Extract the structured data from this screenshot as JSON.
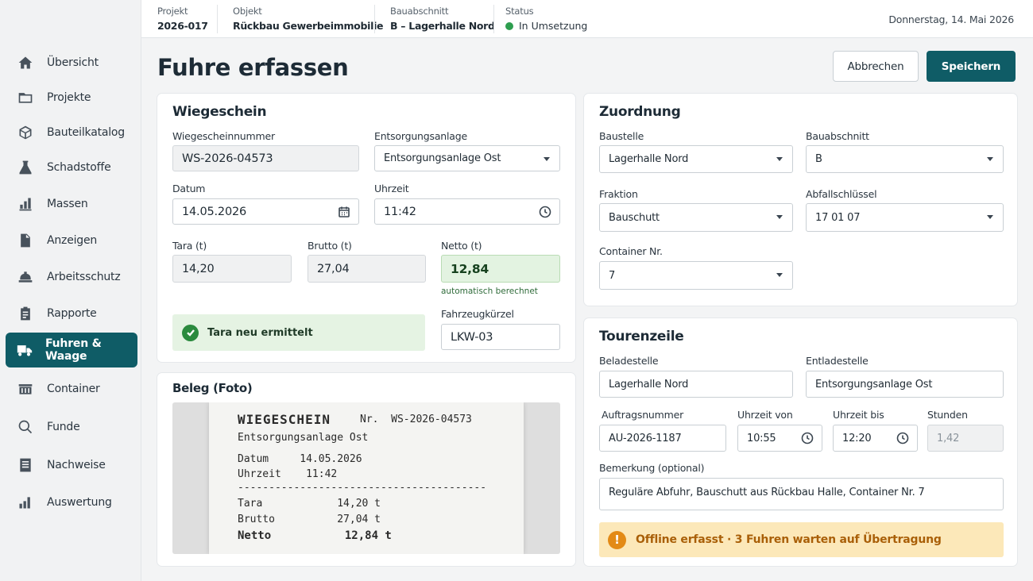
{
  "topbar": {
    "project_label": "Projekt",
    "project_value": "2026-017",
    "object_label": "Objekt",
    "object_value": "Rückbau Gewerbeimmobilie",
    "section_label": "Bauabschnitt",
    "section_value": "B – Lagerhalle Nord",
    "status_label": "Status",
    "status_value": "In Umsetzung",
    "status_color": "#2e9e4f",
    "date": "Donnerstag, 14. Mai 2026"
  },
  "sidebar": {
    "items": [
      {
        "label": "Übersicht",
        "icon": "home-icon"
      },
      {
        "label": "Projekte",
        "icon": "folder-icon"
      },
      {
        "label": "Bauteilkatalog",
        "icon": "cube-icon"
      },
      {
        "label": "Schadstoffe",
        "icon": "flask-icon"
      },
      {
        "label": "Massen",
        "icon": "bar-chart-icon"
      },
      {
        "label": "Anzeigen",
        "icon": "document-icon"
      },
      {
        "label": "Arbeitsschutz",
        "icon": "helmet-icon"
      },
      {
        "label": "Rapporte",
        "icon": "clipboard-icon"
      },
      {
        "label": "Fuhren & Waage",
        "icon": "truck-icon",
        "active": true
      },
      {
        "label": "Container",
        "icon": "container-icon"
      },
      {
        "label": "Funde",
        "icon": "search-icon"
      },
      {
        "label": "Nachweise",
        "icon": "list-document-icon"
      },
      {
        "label": "Auswertung",
        "icon": "analytics-icon"
      }
    ]
  },
  "page": {
    "title": "Fuhre erfassen",
    "cancel_label": "Abbrechen",
    "save_label": "Speichern",
    "accent_color": "#0f5c66"
  },
  "wiegeschein": {
    "title": "Wiegeschein",
    "number_label": "Wiegescheinnummer",
    "number_value": "WS-2026-04573",
    "facility_label": "Entsorgungsanlage",
    "facility_value": "Entsorgungsanlage Ost",
    "date_label": "Datum",
    "date_value": "14.05.2026",
    "time_label": "Uhrzeit",
    "time_value": "11:42",
    "tara_label": "Tara (t)",
    "tara_value": "14,20",
    "brutto_label": "Brutto (t)",
    "brutto_value": "27,04",
    "netto_label": "Netto (t)",
    "netto_value": "12,84",
    "netto_hint": "automatisch berechnet",
    "alert": "Tara neu ermittelt",
    "vehicle_label": "Fahrzeugkürzel",
    "vehicle_value": "LKW-03"
  },
  "beleg": {
    "title": "Beleg (Foto)",
    "receipt": {
      "heading": "WIEGESCHEIN",
      "nr": "Nr.  WS-2026-04573",
      "facility": "Entsorgungsanlage Ost",
      "date_line": "Datum     14.05.2026",
      "time_line": "Uhrzeit    11:42",
      "divider": "----------------------------------------",
      "tara_line": "Tara            14,20 t",
      "brutto_line": "Brutto          27,04 t",
      "netto_line": "Netto           12,84 t"
    }
  },
  "zuordnung": {
    "title": "Zuordnung",
    "site_label": "Baustelle",
    "site_value": "Lagerhalle Nord",
    "section_label": "Bauabschnitt",
    "section_value": "B",
    "fraction_label": "Fraktion",
    "fraction_value": "Bauschutt",
    "waste_key_label": "Abfallschlüssel",
    "waste_key_value": "17 01 07",
    "container_label": "Container Nr.",
    "container_value": "7"
  },
  "tour": {
    "title": "Tourenzeile",
    "load_label": "Beladestelle",
    "load_value": "Lagerhalle Nord",
    "unload_label": "Entladestelle",
    "unload_value": "Entsorgungsanlage Ost",
    "order_label": "Auftragsnummer",
    "order_value": "AU-2026-1187",
    "from_label": "Uhrzeit von",
    "from_value": "10:55",
    "to_label": "Uhrzeit bis",
    "to_value": "12:20",
    "hours_label": "Stunden",
    "hours_value": "1,42",
    "note_label": "Bemerkung (optional)",
    "note_value": "Reguläre Abfuhr, Bauschutt aus Rückbau Halle, Container Nr. 7"
  },
  "offline": {
    "icon": "warning-icon",
    "text": "Offline erfasst · 3 Fuhren warten auf Übertragung"
  }
}
